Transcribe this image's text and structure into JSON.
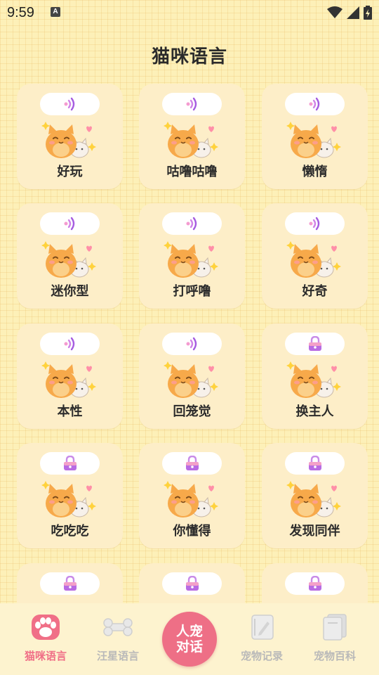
{
  "status": {
    "time": "9:59",
    "notif_glyph": "A"
  },
  "title": "猫咪语言",
  "cards": [
    {
      "label": "好玩",
      "icon": "sound-icon"
    },
    {
      "label": "咕噜咕噜",
      "icon": "sound-icon"
    },
    {
      "label": "懒惰",
      "icon": "sound-icon"
    },
    {
      "label": "迷你型",
      "icon": "sound-icon"
    },
    {
      "label": "打呼噜",
      "icon": "sound-icon"
    },
    {
      "label": "好奇",
      "icon": "sound-icon"
    },
    {
      "label": "本性",
      "icon": "sound-icon"
    },
    {
      "label": "回笼觉",
      "icon": "sound-icon"
    },
    {
      "label": "换主人",
      "icon": "lock-icon"
    },
    {
      "label": "吃吃吃",
      "icon": "lock-icon"
    },
    {
      "label": "你懂得",
      "icon": "lock-icon"
    },
    {
      "label": "发现同伴",
      "icon": "lock-icon"
    },
    {
      "label": "",
      "icon": "lock-icon"
    },
    {
      "label": "",
      "icon": "lock-icon"
    },
    {
      "label": "",
      "icon": "lock-icon"
    }
  ],
  "tabbar": {
    "tabs": [
      {
        "label": "猫咪语言",
        "icon": "paw-icon",
        "active": true
      },
      {
        "label": "汪星语言",
        "icon": "bone-icon",
        "active": false
      },
      {
        "label": "宠物记录",
        "icon": "notebook-icon",
        "active": false
      },
      {
        "label": "宠物百科",
        "icon": "book-icon",
        "active": false
      }
    ],
    "center_button": {
      "line1": "人宠",
      "line2": "对话"
    }
  },
  "colors": {
    "accent": "#ee6f86",
    "background": "#fdf0b8",
    "card": "#fdeec8",
    "tab_inactive": "#b9b9b9"
  }
}
